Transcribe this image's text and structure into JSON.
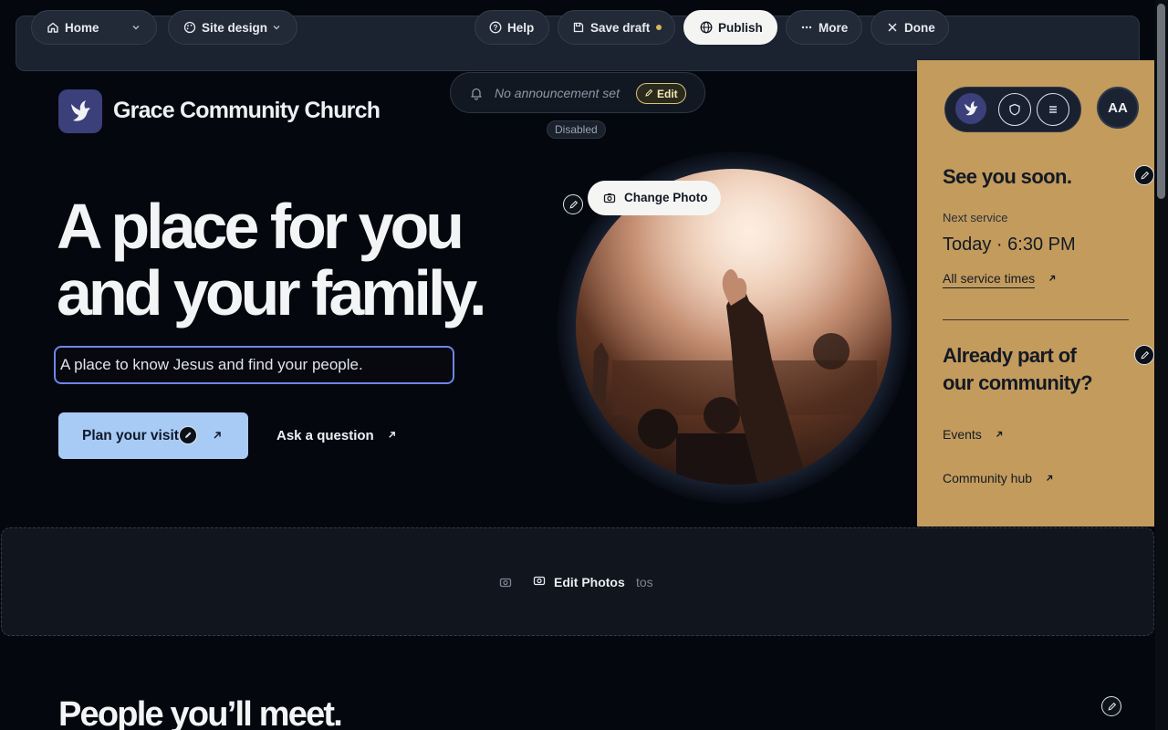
{
  "toolbar": {
    "home_label": "Home",
    "site_design_label": "Site design",
    "help_label": "Help",
    "save_draft_label": "Save draft",
    "publish_label": "Publish",
    "more_label": "More",
    "done_label": "Done"
  },
  "announcement": {
    "text": "No announcement set",
    "edit_label": "Edit",
    "status": "Disabled"
  },
  "brand": {
    "name": "Grace Community Church"
  },
  "hero": {
    "title_line1": "A place for you",
    "title_line2": "and your family.",
    "tagline_value": "A place to know Jesus and find your people.",
    "primary_cta": "Plan your visit",
    "secondary_cta": "Ask a question",
    "change_photo_label": "Change Photo"
  },
  "panel": {
    "heading": "See you soon.",
    "next_service_label": "Next service",
    "next_service_time": "Today · 6:30 PM",
    "all_times_link": "All service times",
    "community_heading_line1": "Already part of",
    "community_heading_line2": "our community?",
    "events_link": "Events",
    "hub_link": "Community hub",
    "avatar_initials": "AA"
  },
  "photos_strip": {
    "edit_label": "Edit Photos",
    "ghost_text": "tos"
  },
  "section": {
    "people_title": "People you’ll meet."
  },
  "colors": {
    "background": "#04070d",
    "accent_blue": "#a8cbf6",
    "panel_gold": "#c29b5d",
    "input_focus": "#6f85e8"
  }
}
